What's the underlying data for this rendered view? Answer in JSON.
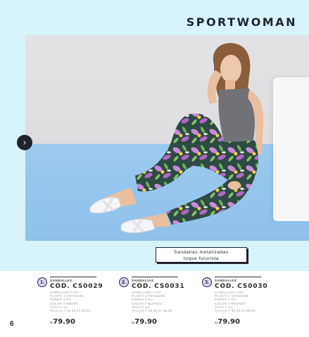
{
  "header": {
    "title": "SPORTWOMAN"
  },
  "photo": {
    "caption_line1": "Sandalias metalizadas",
    "caption_line2": "toque futurista",
    "nav_icon": "chevron-right-icon"
  },
  "products": [
    {
      "number": "1.",
      "category": "SANDALIAS",
      "code": "COD. CS0029",
      "specs": [
        "CAPELLADA // PU",
        "PLANTA // SPANSON",
        "FORRO // PU",
        "COLOR // NEGRO",
        "TACO // 1cl",
        "TALLAS // 35,36,37,38,39"
      ],
      "currency": "S/",
      "price": "79.90"
    },
    {
      "number": "2.",
      "category": "SANDALIAS",
      "code": "COD. CS0031",
      "specs": [
        "CAPELLADA // PU",
        "PLANTA // SPANSON",
        "FORRO // PU",
        "COLOR // BLANCO",
        "TACO // 1cl",
        "TALLAS // 35,36,37,38,39"
      ],
      "currency": "S/",
      "price": "79.90"
    },
    {
      "number": "3.",
      "category": "SANDALIAS",
      "code": "COD. CS0030",
      "specs": [
        "CAPELLADA // PU",
        "PLANTA // SPANSON",
        "FORRO // PU",
        "COLOR // ROSADO",
        "TACO // 1cl",
        "TALLAS // 35,36,37,38,39"
      ],
      "currency": "S/",
      "price": "79.90"
    }
  ],
  "page": {
    "number": "6"
  },
  "colors": {
    "band": "#d8f3f9",
    "floor": "#8fc2ec",
    "wall": "#e0e0e2",
    "ink": "#1e2430"
  }
}
